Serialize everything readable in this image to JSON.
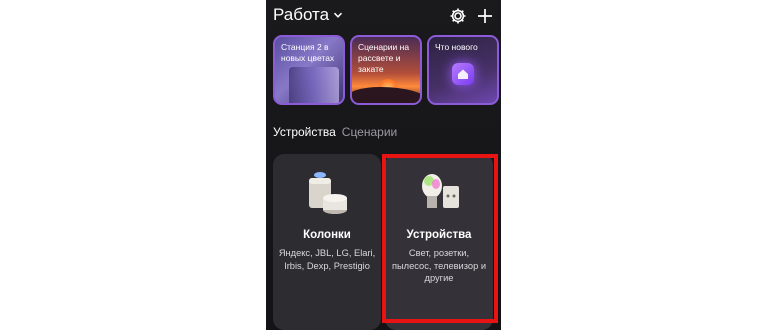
{
  "header": {
    "home_label": "Работа",
    "icons": [
      "chevron-down-icon",
      "gear-icon",
      "plus-icon"
    ]
  },
  "stories": [
    {
      "label": "Станция 2 в новых цветах"
    },
    {
      "label": "Сценарии на рассвете и закате"
    },
    {
      "label": "Что нового"
    }
  ],
  "tabs": [
    {
      "label": "Устройства",
      "active": true
    },
    {
      "label": "Сценарии",
      "active": false
    }
  ],
  "cards": [
    {
      "title": "Колонки",
      "description": "Яндекс, JBL, LG, Elari, Irbis, Dexp, Prestigio"
    },
    {
      "title": "Устройства",
      "description": "Свет, розетки, пылесос, телевизор и другие"
    }
  ],
  "colors": {
    "background": "#131315",
    "card": "#2d2c31",
    "story_border": "#8c5bd8",
    "highlight": "#e81414"
  }
}
